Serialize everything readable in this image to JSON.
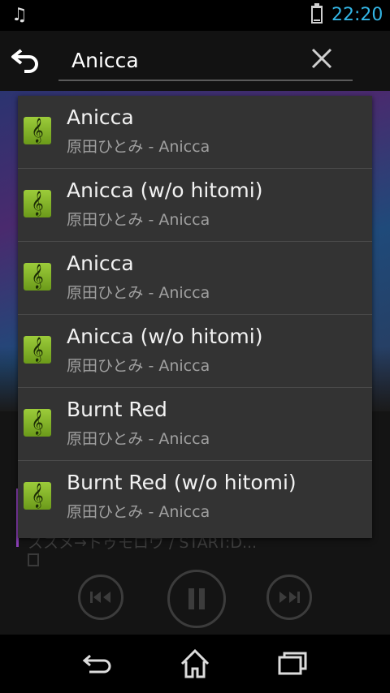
{
  "status_bar": {
    "notification_icon": "music-note-icon",
    "battery_icon": "battery-icon",
    "time": "22:20"
  },
  "search": {
    "back_icon": "back-arrow-icon",
    "query": "Anicca",
    "clear_icon": "close-icon"
  },
  "suggestions": [
    {
      "title": "Anicca",
      "subtitle": "原田ひとみ - Anicca",
      "icon": "music-file-icon"
    },
    {
      "title": "Anicca (w/o hitomi)",
      "subtitle": "原田ひとみ - Anicca",
      "icon": "music-file-icon"
    },
    {
      "title": "Anicca",
      "subtitle": "原田ひとみ - Anicca",
      "icon": "music-file-icon"
    },
    {
      "title": "Anicca (w/o hitomi)",
      "subtitle": "原田ひとみ - Anicca",
      "icon": "music-file-icon"
    },
    {
      "title": "Burnt Red",
      "subtitle": "原田ひとみ - Anicca",
      "icon": "music-file-icon"
    },
    {
      "title": "Burnt Red (w/o hitomi)",
      "subtitle": "原田ひとみ - Anicca",
      "icon": "music-file-icon"
    }
  ],
  "background_player": {
    "track_text": "ススメ→トゥモロウ / START:D..."
  },
  "colors": {
    "clock": "#33b5e5",
    "icon_green": "#8bc34a",
    "dropdown_bg": "#333333"
  }
}
